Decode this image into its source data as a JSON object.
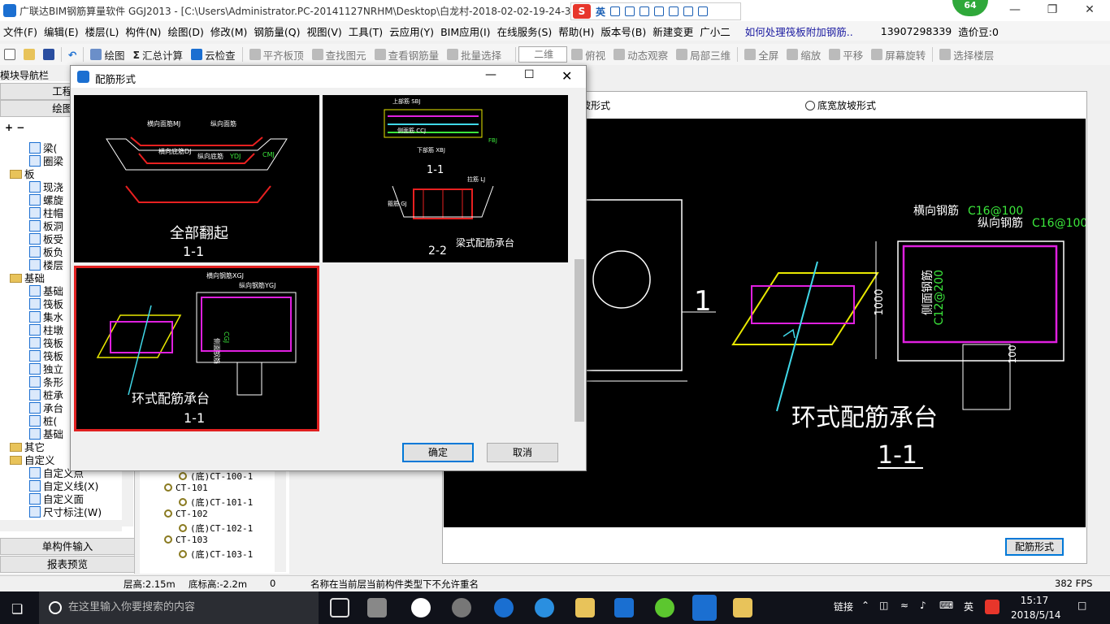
{
  "window": {
    "title": "广联达BIM钢筋算量软件 GGJ2013 - [C:\\Users\\Administrator.PC-20141127NRHM\\Desktop\\白龙村-2018-02-02-19-24-35",
    "badge": "64"
  },
  "ime": {
    "label": "英"
  },
  "menu": [
    "文件(F)",
    "编辑(E)",
    "楼层(L)",
    "构件(N)",
    "绘图(D)",
    "修改(M)",
    "钢筋量(Q)",
    "视图(V)",
    "工具(T)",
    "云应用(Y)",
    "BIM应用(I)",
    "在线服务(S)",
    "帮助(H)",
    "版本号(B)",
    "新建变更",
    "广小二",
    "如何处理筏板附加钢筋..",
    "13907298339",
    "造价豆:0"
  ],
  "toolbar": {
    "draw": "绘图",
    "sum": "汇总计算",
    "cloud_check": "云检查",
    "flat_top": "平齐板顶",
    "find": "查找图元",
    "view_rebar": "查看钢筋量",
    "batch": "批量选择",
    "view2d": "二维",
    "top_view": "俯视",
    "dyn": "动态观察",
    "local3d": "局部三维",
    "full": "全屏",
    "zoom": "缩放",
    "pan": "平移",
    "rotate": "屏幕旋转",
    "select_floor": "选择楼层"
  },
  "nav": {
    "title": "模块导航栏",
    "project": "工程设",
    "draw_input": "绘图输",
    "tree": [
      {
        "label": "梁(",
        "indent": 3,
        "type": "item"
      },
      {
        "label": "圈梁",
        "indent": 3,
        "type": "item"
      },
      {
        "label": "板",
        "indent": 1,
        "type": "folder"
      },
      {
        "label": "现浇",
        "indent": 3,
        "type": "item"
      },
      {
        "label": "螺旋",
        "indent": 3,
        "type": "item"
      },
      {
        "label": "柱帽",
        "indent": 3,
        "type": "item"
      },
      {
        "label": "板洞",
        "indent": 3,
        "type": "item"
      },
      {
        "label": "板受",
        "indent": 3,
        "type": "item"
      },
      {
        "label": "板负",
        "indent": 3,
        "type": "item"
      },
      {
        "label": "楼层",
        "indent": 3,
        "type": "item"
      },
      {
        "label": "基础",
        "indent": 1,
        "type": "folder"
      },
      {
        "label": "基础",
        "indent": 3,
        "type": "item"
      },
      {
        "label": "筏板",
        "indent": 3,
        "type": "item"
      },
      {
        "label": "集水",
        "indent": 3,
        "type": "item"
      },
      {
        "label": "柱墩",
        "indent": 3,
        "type": "item"
      },
      {
        "label": "筏板",
        "indent": 3,
        "type": "item"
      },
      {
        "label": "筏板",
        "indent": 3,
        "type": "item"
      },
      {
        "label": "独立",
        "indent": 3,
        "type": "item"
      },
      {
        "label": "条形",
        "indent": 3,
        "type": "item"
      },
      {
        "label": "桩承",
        "indent": 3,
        "type": "item"
      },
      {
        "label": "承台",
        "indent": 3,
        "type": "item"
      },
      {
        "label": "桩(",
        "indent": 3,
        "type": "item"
      },
      {
        "label": "基础",
        "indent": 3,
        "type": "item"
      },
      {
        "label": "其它",
        "indent": 1,
        "type": "folder"
      },
      {
        "label": "自定义",
        "indent": 1,
        "type": "folder"
      },
      {
        "label": "自定义点",
        "indent": 3,
        "type": "item"
      },
      {
        "label": "自定义线(X)",
        "indent": 3,
        "type": "item"
      },
      {
        "label": "自定义面",
        "indent": 3,
        "type": "item"
      },
      {
        "label": "尺寸标注(W)",
        "indent": 3,
        "type": "item"
      }
    ],
    "single_input": "单构件输入",
    "report": "报表预览"
  },
  "component_tree": [
    {
      "label": "(底)CT-100-1",
      "level": 2
    },
    {
      "label": "CT-101",
      "level": 1
    },
    {
      "label": "(底)CT-101-1",
      "level": 2
    },
    {
      "label": "CT-102",
      "level": 1
    },
    {
      "label": "(底)CT-102-1",
      "level": 2
    },
    {
      "label": "CT-103",
      "level": 1
    },
    {
      "label": "(底)CT-103-1",
      "level": 2
    }
  ],
  "right": {
    "radio_a": "坡形式",
    "radio_b": "底宽放坡形式",
    "config_button": "配筋形式",
    "cad": {
      "title": "环式配筋承台",
      "section": "1-1",
      "label_1": "1",
      "transverse": "横向钢筋",
      "transverse_val": "C16@100",
      "longitudinal": "纵向钢筋",
      "longitudinal_val": "C16@100",
      "side": "侧面钢筋",
      "side_val": "C12@200",
      "dim_h": "1000",
      "dim_b": "100"
    }
  },
  "dialog": {
    "title": "配筋形式",
    "ok": "确定",
    "cancel": "取消",
    "options": [
      {
        "title": "全部翻起",
        "section": "1-1",
        "labels": {
          "a": "横向面筋MJ",
          "b": "纵向面筋",
          "c": "横向底筋DJ",
          "d": "纵向底筋",
          "e": "CMJ",
          "f": "YDJ"
        }
      },
      {
        "title": "梁式配筋承台",
        "section": "2-2",
        "section_top": "1-1",
        "labels": {
          "a": "上部筋 SBJ",
          "b": "侧面筋 CCJ",
          "c": "下部筋 XBJ",
          "d": "FBJ",
          "e": "拉筋 LJ",
          "f": "箍筋 GJ"
        }
      },
      {
        "title": "环式配筋承台",
        "section": "1-1",
        "labels": {
          "a": "横向钢筋XGJ",
          "b": "纵向钢筋YGJ",
          "c": "侧面钢筋",
          "d": "CGJ"
        }
      }
    ]
  },
  "status": {
    "floor_h": "层高:2.15m",
    "bottom": "底标高:-2.2m",
    "zero": "0",
    "msg": "名称在当前层当前构件类型下不允许重名",
    "fps": "382 FPS"
  },
  "taskbar": {
    "search": "在这里输入你要搜索的内容",
    "link": "链接",
    "ime": "英",
    "time": "15:17",
    "date": "2018/5/14"
  }
}
